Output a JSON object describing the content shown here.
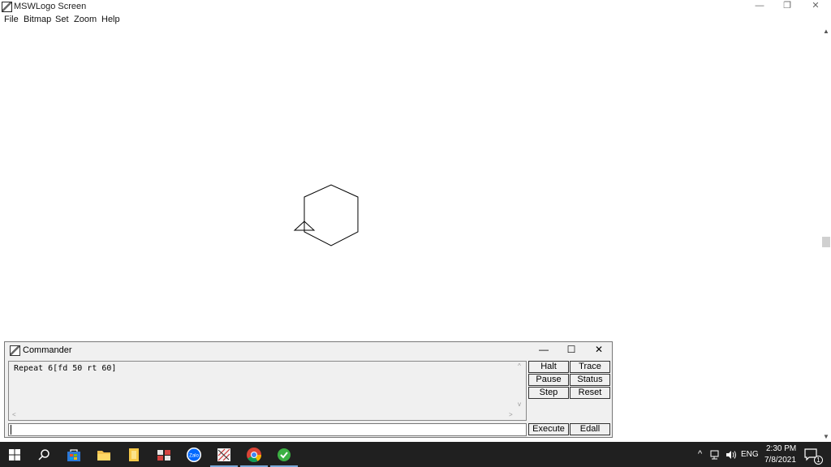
{
  "window": {
    "title": "MSWLogo Screen",
    "minimize_glyph": "—",
    "restore_glyph": "❐",
    "close_glyph": "✕"
  },
  "menu": [
    "File",
    "Bitmap",
    "Set",
    "Zoom",
    "Help"
  ],
  "scrollbar": {
    "up_glyph": "▲",
    "down_glyph": "▼"
  },
  "commander": {
    "title": "Commander",
    "minimize_glyph": "—",
    "maximize_glyph": "☐",
    "close_glyph": "✕",
    "history_text": "Repeat 6[fd 50 rt 60]",
    "input_value": "",
    "buttons": {
      "halt": "Halt",
      "trace": "Trace",
      "pause": "Pause",
      "status": "Status",
      "step": "Step",
      "reset": "Reset",
      "execute": "Execute",
      "edall": "Edall"
    }
  },
  "taskbar": {
    "icons": [
      "windows-start-icon",
      "search-icon",
      "store-icon",
      "file-explorer-icon",
      "sticky-notes-icon",
      "snipping-tool-icon",
      "zalo-icon",
      "mswlogo-icon",
      "chrome-icon",
      "evkey-icon"
    ],
    "tray": {
      "chevron_glyph": "^",
      "language": "ENG",
      "time": "2:30 PM",
      "date": "7/8/2021",
      "notification_count": "1"
    }
  },
  "colors": {
    "taskbar_bg": "#202020",
    "chrome_blue": "#4285f4",
    "zalo_blue": "#0068ff",
    "evkey_green": "#3cb043"
  }
}
